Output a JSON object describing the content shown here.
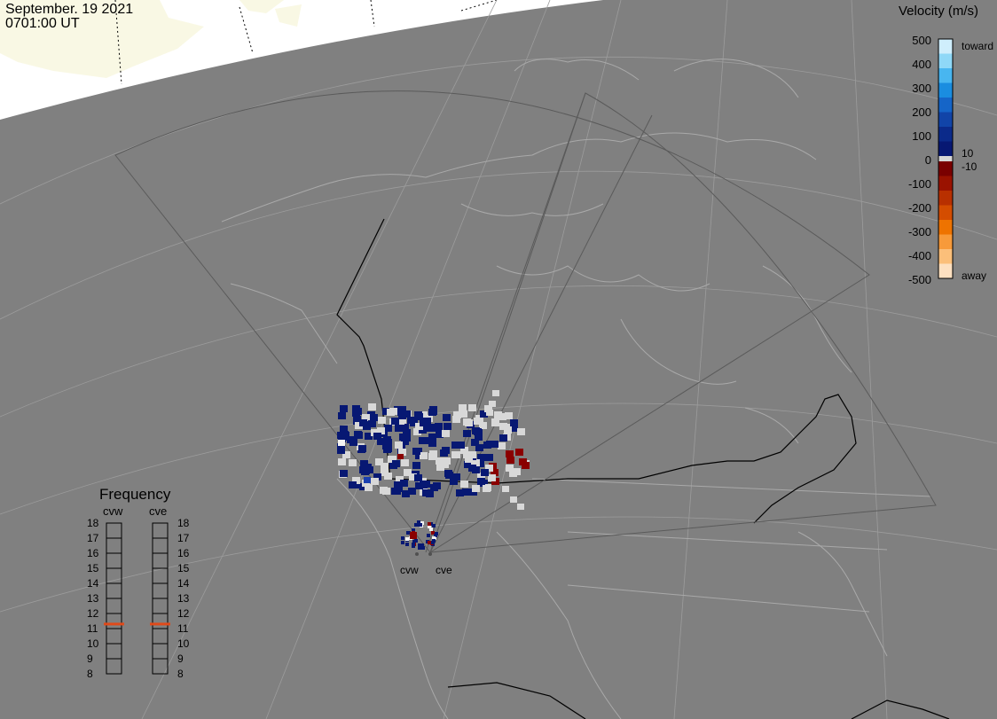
{
  "header": {
    "date": "September. 19 2021",
    "time": "0701:00 UT"
  },
  "colorbar": {
    "title": "Velocity (m/s)",
    "ticks": [
      "500",
      "400",
      "300",
      "200",
      "100",
      "0",
      "-100",
      "-200",
      "-300",
      "-400",
      "-500"
    ],
    "toward_label": "toward",
    "away_label": "away",
    "pos_threshold": "10",
    "neg_threshold": "-10",
    "colors_toward": [
      "#cfeefc",
      "#8fd8f7",
      "#48b6f0",
      "#1a8de0",
      "#1565c8",
      "#1144a8",
      "#0b2a8a",
      "#071873"
    ],
    "colors_away": [
      "#7a0000",
      "#9a1200",
      "#b83000",
      "#d44d00",
      "#ee7300",
      "#f79a3a",
      "#fbbf7a",
      "#fde0c0"
    ]
  },
  "frequency": {
    "title": "Frequency",
    "radars": [
      "cvw",
      "cve"
    ],
    "ticks": [
      "18",
      "17",
      "16",
      "15",
      "14",
      "13",
      "12",
      "11",
      "10",
      "9",
      "8"
    ],
    "cvw_mhz": 10.8,
    "cve_mhz": 10.8,
    "marker_color": "#e04a1a"
  },
  "map": {
    "radar_labels": [
      "cvw",
      "cve"
    ],
    "colors": {
      "land": "#808080",
      "ocean_edge": "#ffffff",
      "sea_ice": "#f9f8e4",
      "grid": "#9c9c9c",
      "fov": "#5a5a5a"
    }
  }
}
